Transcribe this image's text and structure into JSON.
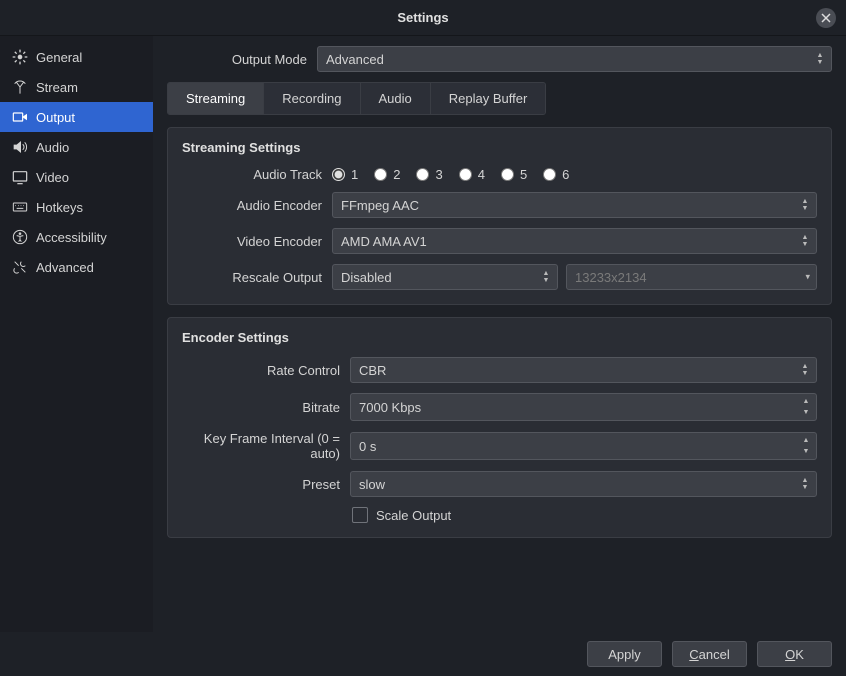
{
  "title": "Settings",
  "sidebar": {
    "items": [
      {
        "label": "General"
      },
      {
        "label": "Stream"
      },
      {
        "label": "Output"
      },
      {
        "label": "Audio"
      },
      {
        "label": "Video"
      },
      {
        "label": "Hotkeys"
      },
      {
        "label": "Accessibility"
      },
      {
        "label": "Advanced"
      }
    ]
  },
  "outputMode": {
    "label": "Output Mode",
    "value": "Advanced"
  },
  "tabs": [
    {
      "label": "Streaming"
    },
    {
      "label": "Recording"
    },
    {
      "label": "Audio"
    },
    {
      "label": "Replay Buffer"
    }
  ],
  "streaming": {
    "section_title": "Streaming Settings",
    "audio_track_label": "Audio Track",
    "audio_tracks": [
      "1",
      "2",
      "3",
      "4",
      "5",
      "6"
    ],
    "audio_encoder_label": "Audio Encoder",
    "audio_encoder_value": "FFmpeg AAC",
    "video_encoder_label": "Video Encoder",
    "video_encoder_value": "AMD AMA AV1",
    "rescale_label": "Rescale Output",
    "rescale_value": "Disabled",
    "rescale_resolution": "13233x2134"
  },
  "encoder": {
    "section_title": "Encoder Settings",
    "rate_control_label": "Rate Control",
    "rate_control_value": "CBR",
    "bitrate_label": "Bitrate",
    "bitrate_value": "7000 Kbps",
    "keyframe_label": "Key Frame Interval (0 = auto)",
    "keyframe_value": "0 s",
    "preset_label": "Preset",
    "preset_value": "slow",
    "scale_output_label": "Scale Output"
  },
  "footer": {
    "apply": "Apply",
    "cancel": "Cancel",
    "ok": "OK"
  }
}
